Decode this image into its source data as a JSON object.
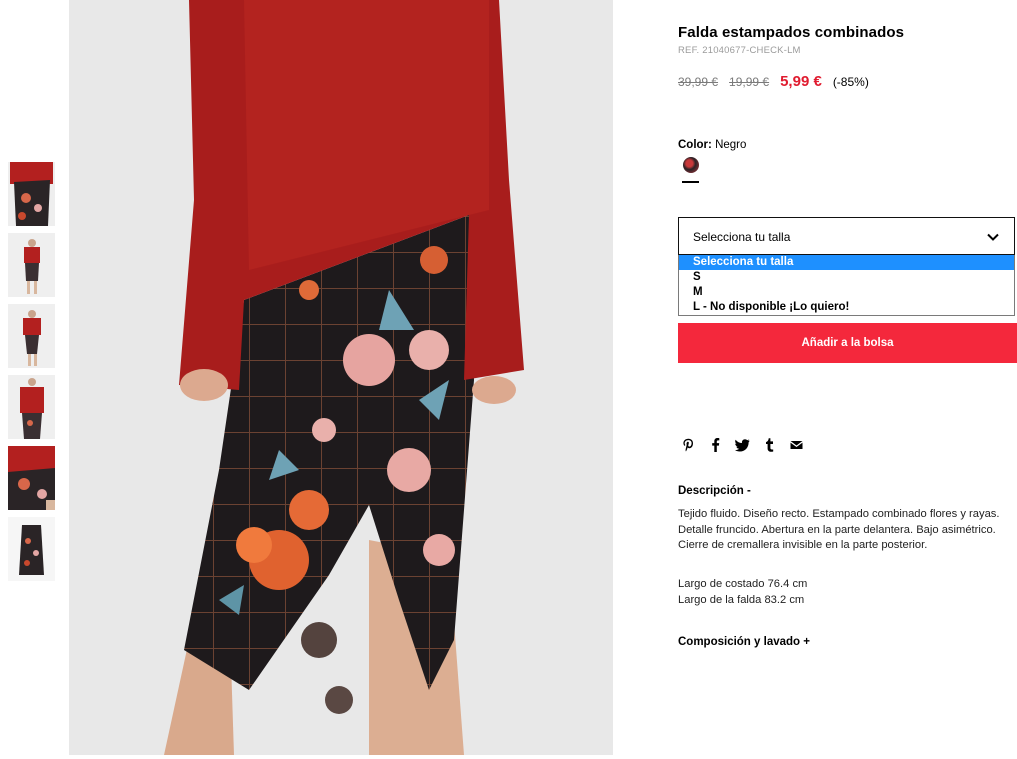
{
  "product": {
    "title": "Falda estampados combinados",
    "ref": "REF. 21040677-CHECK-LM",
    "price_original": "39,99 €",
    "price_previous": "19,99 €",
    "price_current": "5,99 €",
    "discount": "(-85%)"
  },
  "color": {
    "label": "Color:",
    "value": "Negro",
    "swatch_icon": "floral-print-swatch"
  },
  "size_select": {
    "value": "Selecciona tu talla",
    "options": [
      "Selecciona tu talla",
      "S",
      "M",
      "L - No disponible ¡Lo quiero!"
    ],
    "selected_index": 0
  },
  "cart": {
    "button_label": "Añadir a la bolsa"
  },
  "share_icons": [
    "pinterest-icon",
    "facebook-icon",
    "twitter-icon",
    "tumblr-icon",
    "mail-icon"
  ],
  "description": {
    "heading": "Descripción  -",
    "text": "Tejido fluido. Diseño recto. Estampado combinado flores y rayas. Detalle fruncido. Abertura en la parte delantera. Bajo asimétrico. Cierre de cremallera invisible en la parte posterior.",
    "measure_1": "Largo de costado 76.4 cm",
    "measure_2": "Largo de la falda 83.2 cm"
  },
  "composition": {
    "heading": "Composición y lavado  +"
  },
  "colors": {
    "accent": "#f4283c",
    "sale_price": "#e01b2f",
    "selected_option": "#1e90ff"
  }
}
